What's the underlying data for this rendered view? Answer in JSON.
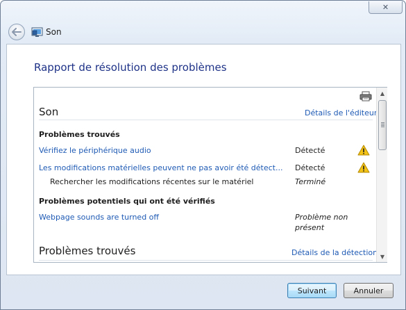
{
  "window": {
    "title": "Son",
    "close_glyph": "✕"
  },
  "main": {
    "heading": "Rapport de résolution des problèmes"
  },
  "report": {
    "section1": {
      "title": "Son",
      "publisher_link": "Détails de l'éditeur"
    },
    "found": {
      "header": "Problèmes trouvés",
      "rows": [
        {
          "label": "Vérifiez le périphérique audio",
          "status": "Détecté",
          "icon": "warning-icon"
        },
        {
          "label": "Les modifications matérielles peuvent ne pas avoir été détect...",
          "status": "Détecté",
          "icon": "warning-icon"
        }
      ],
      "subrow": {
        "label": "Rechercher les modifications récentes sur le matériel",
        "status": "Terminé"
      }
    },
    "checked": {
      "header": "Problèmes potentiels qui ont été vérifiés",
      "row": {
        "label": "Webpage sounds are turned off",
        "status_line1": "Problème non",
        "status_line2": "présent"
      }
    },
    "section2": {
      "title": "Problèmes trouvés",
      "detection_link": "Détails de la détection"
    }
  },
  "buttons": {
    "next": "Suivant",
    "cancel": "Annuler"
  },
  "colors": {
    "link": "#1e5ab4",
    "heading": "#1e3287",
    "warning": "#f3c317"
  }
}
